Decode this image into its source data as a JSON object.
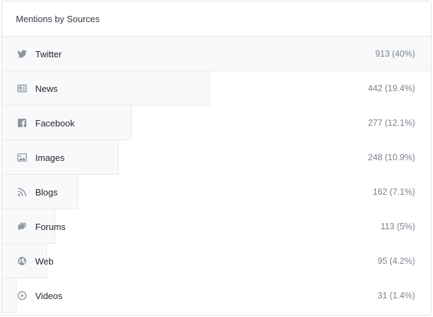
{
  "widget": {
    "title": "Mentions by Sources"
  },
  "sources": [
    {
      "label": "Twitter",
      "value_text": "913 (40%)",
      "share": 1.0,
      "icon": "twitter-icon"
    },
    {
      "label": "News",
      "value_text": "442 (19.4%)",
      "share": 0.484,
      "icon": "news-icon"
    },
    {
      "label": "Facebook",
      "value_text": "277 (12.1%)",
      "share": 0.303,
      "icon": "facebook-icon"
    },
    {
      "label": "Images",
      "value_text": "248 (10.9%)",
      "share": 0.272,
      "icon": "image-icon"
    },
    {
      "label": "Blogs",
      "value_text": "162 (7.1%)",
      "share": 0.177,
      "icon": "rss-icon"
    },
    {
      "label": "Forums",
      "value_text": "113 (5%)",
      "share": 0.124,
      "icon": "forum-icon"
    },
    {
      "label": "Web",
      "value_text": "95 (4.2%)",
      "share": 0.104,
      "icon": "globe-icon"
    },
    {
      "label": "Videos",
      "value_text": "31 (1.4%)",
      "share": 0.034,
      "icon": "play-icon"
    }
  ],
  "colors": {
    "bar_fill": "#f8f9fb",
    "icon": "#8e959e"
  }
}
